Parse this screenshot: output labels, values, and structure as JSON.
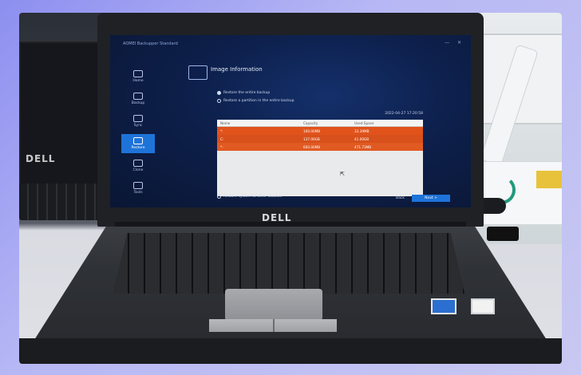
{
  "laptop": {
    "brand_lid": "DELL",
    "brand_monitor_left": "DELL"
  },
  "screen": {
    "app_title": "AOMEI Backupper Standard",
    "section_title": "Image Information",
    "sidebar": [
      {
        "label": "Home"
      },
      {
        "label": "Backup"
      },
      {
        "label": "Sync"
      },
      {
        "label": "Restore",
        "active": true
      },
      {
        "label": "Clone"
      },
      {
        "label": "Tools"
      }
    ],
    "options": {
      "restore_entire": "Restore the entire backup",
      "restore_partition": "Restore a partition in the entire backup",
      "restore_other": "Restore system to other location"
    },
    "date": "2022-04-27 17:20:58",
    "table": {
      "headers": [
        "Name",
        "Capacity",
        "Used Space"
      ],
      "rows": [
        [
          "*:",
          "100.00MB",
          "33.39MB"
        ],
        [
          "C:",
          "137.00GB",
          "41.00GB"
        ],
        [
          "*:",
          "600.00MB",
          "471.73MB"
        ]
      ]
    },
    "buttons": {
      "back": "Back",
      "next": "Next >"
    }
  },
  "colors": {
    "selection": "#e1531b",
    "accent_blue": "#1e73d9"
  }
}
